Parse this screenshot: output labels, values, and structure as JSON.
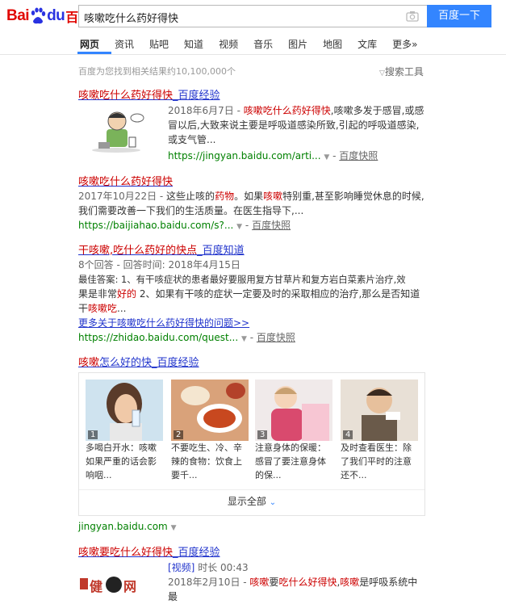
{
  "header": {
    "logo_bai": "Bai",
    "logo_du": "du",
    "logo_cn": "百度",
    "query": "咳嗽吃什么药好得快",
    "search_button": "百度一下"
  },
  "tabs": [
    {
      "label": "网页"
    },
    {
      "label": "资讯"
    },
    {
      "label": "贴吧"
    },
    {
      "label": "知道"
    },
    {
      "label": "视频"
    },
    {
      "label": "音乐"
    },
    {
      "label": "图片"
    },
    {
      "label": "地图"
    },
    {
      "label": "文库"
    },
    {
      "label": "更多»"
    }
  ],
  "result_count": "百度为您找到相关结果约10,100,000个",
  "search_tools": "搜索工具",
  "r1": {
    "title_a": "咳嗽吃什么药好得快",
    "title_b": "_百度经验",
    "date": "2018年6月7日 - ",
    "hl": "咳嗽吃什么药好得快",
    "line1_rest": ",咳嗽多发于感冒,或感",
    "line2": "冒以后,大致来说主要是呼吸道感染所致,引起的呼吸道感染,",
    "line3": "或支气管...",
    "url": "https://jingyan.baidu.com/arti...",
    "cache": "百度快照"
  },
  "r2": {
    "title": "咳嗽吃什么药好得快",
    "date": "2017年10月22日 - ",
    "l1a": "这些止咳的",
    "l1b": "药物",
    "l1c": "。如果",
    "l1d": "咳嗽",
    "l1e": "特别重,甚至影响睡觉休息的时候,",
    "line2": "我们需要改善一下我们的生活质量。在医生指导下,...",
    "url": "https://baijiahao.baidu.com/s?...",
    "cache": "百度快照"
  },
  "r3": {
    "title_a": "干咳嗽,吃什么药好的快点",
    "title_b": "_百度知道",
    "meta": "8个回答 - 回答时间: 2018年4月15日",
    "l1": "最佳答案: 1、有干咳症状的患者最好要服用复方甘草片和复方岩白菜素片治疗,效",
    "l2a": "果是非常",
    "l2b": "好的",
    "l2c": " 2、如果有干咳的症状一定要及时的采取相应的治疗,那么是否知道",
    "l3a": "干",
    "l3b": "咳嗽吃",
    "l3c": "...",
    "more": "更多关于咳嗽吃什么药好得快的问题>>",
    "url": "https://zhidao.baidu.com/quest...",
    "cache": "百度快照"
  },
  "r4": {
    "title_a": "咳嗽",
    "title_b": "怎么好的快",
    "title_c": "_百度经验",
    "steps": [
      {
        "num": "1",
        "c1": "多喝白开水：咳嗽",
        "c2": "如果严重的话会影",
        "c3": "响咽..."
      },
      {
        "num": "2",
        "c1": "不要吃生、冷、辛",
        "c2": "辣的食物：饮食上",
        "c3": "要千..."
      },
      {
        "num": "3",
        "c1": "注意身体的保暖：",
        "c2": "感冒了要注意身体",
        "c3": "的保..."
      },
      {
        "num": "4",
        "c1": "及时查看医生：除",
        "c2": "了我们平时的注意",
        "c3": "还不..."
      }
    ],
    "show_all": "显示全部",
    "url": "jingyan.baidu.com"
  },
  "r5": {
    "title_a": "咳嗽要吃什么好得快",
    "title_b": "_百度经验",
    "video_tag": "[视频]",
    "duration": " 时长 00:43",
    "date": "2018年2月10日 - ",
    "hl1": "咳嗽",
    "mid": "要",
    "hl2": "吃什么好得快",
    "comma": ",",
    "hl3": "咳嗽",
    "rest": "是呼吸系统中最"
  },
  "colors": {
    "accent": "#3385ff",
    "link": "#2134cc",
    "highlight": "#c00000",
    "url": "#008000",
    "brand": "#e10601"
  }
}
